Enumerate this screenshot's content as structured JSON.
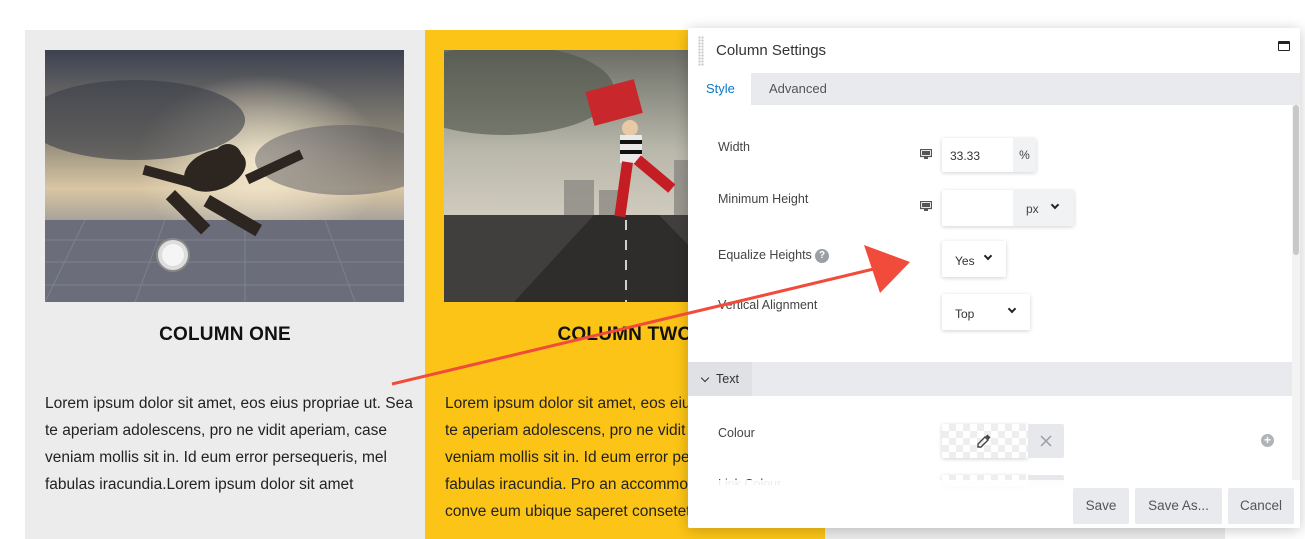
{
  "columns": [
    {
      "heading": "COLUMN ONE",
      "text": "Lorem ipsum dolor sit amet, eos eius propriae ut. Sea te aperiam adolescens, pro ne vidit aperiam, case veniam mollis sit in. Id eum error persequeris, mel fabulas iracundia.Lorem ipsum dolor sit amet",
      "background": "#ececec"
    },
    {
      "heading": "COLUMN TWO",
      "text": "Lorem ipsum dolor sit amet, eos eius propriae ut. Sea te aperiam adolescens, pro ne vidit aperiam, case veniam mollis sit in. Id eum error persequeris, mel fabulas iracundia. Pro an accommodare no. Insolens conve eum ubique saperet consetetur no",
      "background": "#fcc416"
    },
    {
      "heading": "",
      "text": "",
      "background": "#ececec"
    }
  ],
  "panel": {
    "title": "Column Settings",
    "tabs": [
      {
        "label": "Style",
        "active": true
      },
      {
        "label": "Advanced",
        "active": false
      }
    ],
    "fields": {
      "width": {
        "label": "Width",
        "value": "33.33",
        "unit": "%"
      },
      "min_height": {
        "label": "Minimum Height",
        "value": "",
        "unit": "px"
      },
      "equalize_heights": {
        "label": "Equalize Heights",
        "value": "Yes"
      },
      "vertical_alignment": {
        "label": "Vertical Alignment",
        "value": "Top"
      }
    },
    "section": {
      "label": "Text"
    },
    "colour": {
      "label": "Colour"
    },
    "link_colour": {
      "label": "Link Colour"
    },
    "buttons": {
      "save": "Save",
      "save_as": "Save As...",
      "cancel": "Cancel"
    }
  },
  "colors": {
    "accent": "#0b78c9",
    "arrow": "#f04b3b",
    "column_yellow": "#fcc416",
    "column_grey": "#ececec"
  }
}
